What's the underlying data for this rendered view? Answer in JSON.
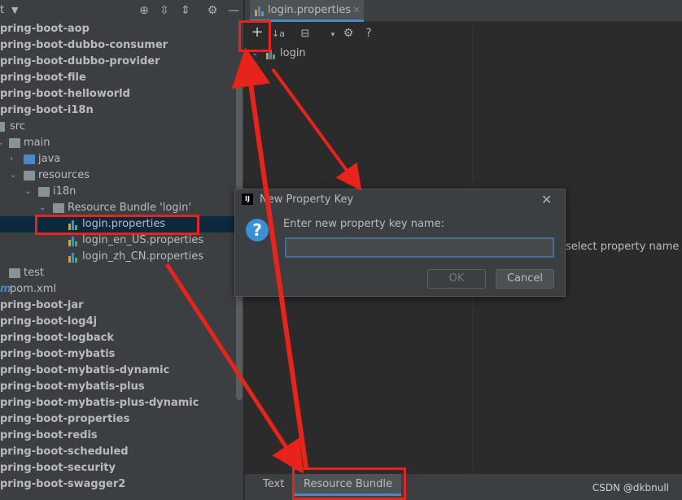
{
  "project": {
    "title_fragment": "t",
    "toolbar_icons": [
      "target-icon",
      "expand-icon",
      "collapse-icon",
      "gear-icon",
      "minimize-icon"
    ],
    "tree": [
      {
        "label": "pring-boot-aop",
        "bold": true
      },
      {
        "label": "pring-boot-dubbo-consumer",
        "bold": true
      },
      {
        "label": "pring-boot-dubbo-provider",
        "bold": true
      },
      {
        "label": "pring-boot-file",
        "bold": true
      },
      {
        "label": "pring-boot-helloworld",
        "bold": true
      },
      {
        "label": "pring-boot-i18n",
        "bold": true
      },
      {
        "label": "src",
        "bold": false
      },
      {
        "label": "main",
        "bold": false
      },
      {
        "label": "java",
        "bold": false
      },
      {
        "label": "resources",
        "bold": false
      },
      {
        "label": "i18n",
        "bold": false
      },
      {
        "label": "Resource Bundle 'login'",
        "bold": false
      },
      {
        "label": "login.properties",
        "bold": false
      },
      {
        "label": "login_en_US.properties",
        "bold": false
      },
      {
        "label": "login_zh_CN.properties",
        "bold": false
      },
      {
        "label": "test",
        "bold": false
      },
      {
        "label": "pom.xml",
        "bold": false
      },
      {
        "label": "pring-boot-jar",
        "bold": true
      },
      {
        "label": "pring-boot-log4j",
        "bold": true
      },
      {
        "label": "pring-boot-logback",
        "bold": true
      },
      {
        "label": "pring-boot-mybatis",
        "bold": true
      },
      {
        "label": "pring-boot-mybatis-dynamic",
        "bold": true
      },
      {
        "label": "pring-boot-mybatis-plus",
        "bold": true
      },
      {
        "label": "pring-boot-mybatis-plus-dynamic",
        "bold": true
      },
      {
        "label": "pring-boot-properties",
        "bold": true
      },
      {
        "label": "pring-boot-redis",
        "bold": true
      },
      {
        "label": "pring-boot-scheduled",
        "bold": true
      },
      {
        "label": "pring-boot-security",
        "bold": true
      },
      {
        "label": "pring-boot-swagger2",
        "bold": true
      }
    ]
  },
  "editor": {
    "tab_label": "login.properties",
    "toolbar": {
      "add": "+",
      "sort": "↓a",
      "help": "?"
    },
    "tree_root": "login",
    "right_message": "select property name on",
    "bottom_tabs": {
      "text": "Text",
      "resource_bundle": "Resource Bundle"
    },
    "watermark": "CSDN @dkbnull"
  },
  "dialog": {
    "logo": "IJ",
    "title": "New Property Key",
    "prompt": "Enter new property key name:",
    "input_value": "",
    "ok": "OK",
    "cancel": "Cancel",
    "question_mark": "?"
  },
  "colors": {
    "annotation": "#e8231b",
    "accent": "#4a88c7",
    "background": "#2b2b2b",
    "panel": "#3c3f41"
  }
}
